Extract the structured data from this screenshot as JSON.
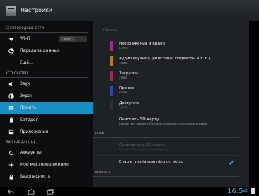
{
  "app": {
    "title": "Настройки",
    "icon": "settings-app-icon"
  },
  "sidebar": {
    "sections": [
      {
        "title": "БЕСПРОВОДНЫЕ СЕТИ"
      },
      {
        "title": "УСТРОЙСТВО"
      },
      {
        "title": "ЛИЧНЫЕ ДАННЫЕ"
      }
    ],
    "items": [
      {
        "label": "Wi-Fi",
        "icon": "wifi-icon",
        "toggle": "ВЫКЛ"
      },
      {
        "label": "Передача данных",
        "icon": "data-usage-icon"
      },
      {
        "label": "Ещё..."
      },
      {
        "label": "Звук",
        "icon": "speaker-icon"
      },
      {
        "label": "Экран",
        "icon": "brightness-icon"
      },
      {
        "label": "Память",
        "icon": "storage-icon",
        "active": true
      },
      {
        "label": "Батарея",
        "icon": "battery-icon"
      },
      {
        "label": "Приложения",
        "icon": "apps-icon"
      },
      {
        "label": "Аккаунты",
        "icon": "sync-icon"
      },
      {
        "label": "Мое местоположение",
        "icon": "location-icon"
      },
      {
        "label": "Безопасность",
        "icon": "lock-icon"
      }
    ]
  },
  "main": {
    "header": "Память",
    "storage": [
      {
        "title": "Изображения и видео",
        "sub": "8,39ГБ",
        "color": "#9c2f8a"
      },
      {
        "title": "Аудио (музыка, рингтоны, подкасты и т. п.)",
        "sub": "798МБ",
        "color": "#b07a2b"
      },
      {
        "title": "Загрузки",
        "sub": "276КБ",
        "color": "#a3284e"
      },
      {
        "title": "Прочее",
        "sub": "805МБ",
        "color": "#3a44a8"
      },
      {
        "title": "Доступно",
        "sub": "2,61ГБ",
        "color": "#2b2f31"
      }
    ],
    "unmount": {
      "title": "Очистить SD-карту",
      "sub": "Удаляет все данные с SD-карты, например музыку и фотографии"
    },
    "extsd_section": "EXTSD",
    "mount": {
      "title": "Подключить SD-карту",
      "sub": "Вставьте SD-карту для подключения"
    },
    "media_scan": {
      "label": "Enable media scanning on extsd",
      "checked": true
    },
    "usbhost_section": "USBHOST1"
  },
  "statusbar": {
    "time": "16:54"
  }
}
